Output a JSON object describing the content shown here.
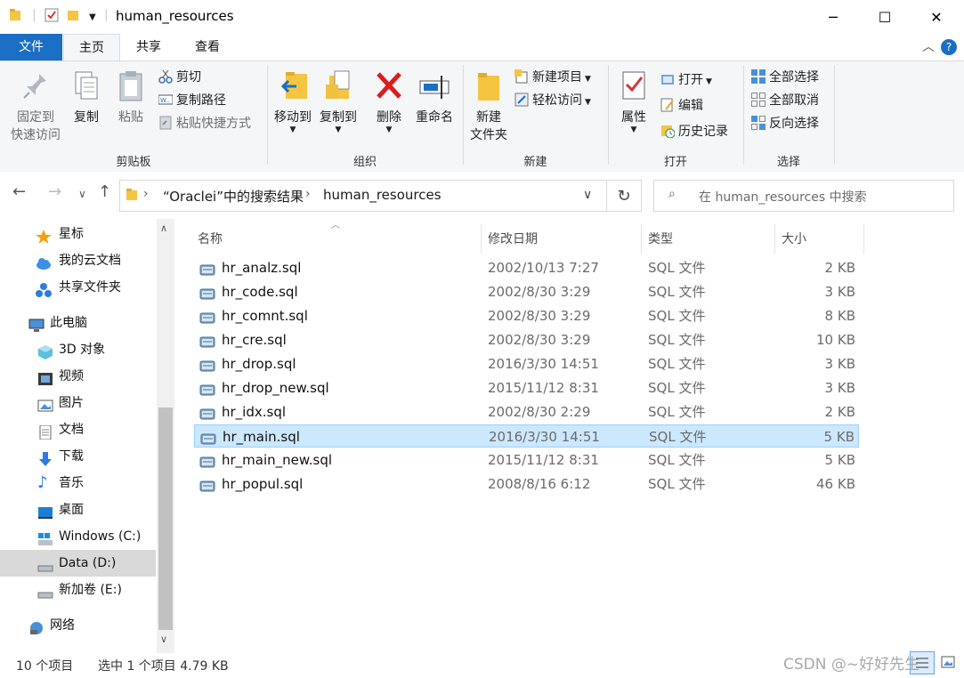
{
  "window": {
    "title": "human_resources",
    "minimize_icon": "minimize-icon",
    "maximize_icon": "maximize-icon",
    "close_icon": "close-icon"
  },
  "tabs": [
    {
      "label": "文件"
    },
    {
      "label": "主页"
    },
    {
      "label": "共享"
    },
    {
      "label": "查看"
    }
  ],
  "ribbon": {
    "clipboard": {
      "pin_label_1": "固定到",
      "pin_label_2": "快速访问",
      "copy": "复制",
      "paste": "粘贴",
      "cut": "剪切",
      "copy_path": "复制路径",
      "paste_shortcut": "粘贴快捷方式",
      "group": "剪贴板"
    },
    "organize": {
      "move_to": "移动到",
      "copy_to": "复制到",
      "delete": "删除",
      "rename": "重命名",
      "group": "组织"
    },
    "new": {
      "new_folder_1": "新建",
      "new_folder_2": "文件夹",
      "new_item": "新建项目",
      "easy_access": "轻松访问",
      "group": "新建"
    },
    "open": {
      "properties": "属性",
      "open": "打开",
      "edit": "编辑",
      "history": "历史记录",
      "group": "打开"
    },
    "select": {
      "select_all": "全部选择",
      "select_none": "全部取消",
      "invert": "反向选择",
      "group": "选择"
    }
  },
  "address": {
    "crumb_1": "“Oraclei”中的搜索结果",
    "crumb_2": "human_resources",
    "search_placeholder": "在 human_resources 中搜索"
  },
  "sidebar": {
    "items": [
      {
        "label": "星标",
        "icon": "star-icon"
      },
      {
        "label": "我的云文档",
        "icon": "cloud-icon"
      },
      {
        "label": "共享文件夹",
        "icon": "share-icon"
      },
      {
        "label": "此电脑",
        "icon": "computer-icon"
      },
      {
        "label": "3D 对象",
        "icon": "3d-objects-icon"
      },
      {
        "label": "视频",
        "icon": "video-icon"
      },
      {
        "label": "图片",
        "icon": "pictures-icon"
      },
      {
        "label": "文档",
        "icon": "documents-icon"
      },
      {
        "label": "下载",
        "icon": "download-icon"
      },
      {
        "label": "音乐",
        "icon": "music-icon"
      },
      {
        "label": "桌面",
        "icon": "desktop-icon"
      },
      {
        "label": "Windows (C:)",
        "icon": "drive-icon"
      },
      {
        "label": "Data (D:)",
        "icon": "drive-icon"
      },
      {
        "label": "新加卷 (E:)",
        "icon": "drive-icon"
      },
      {
        "label": "网络",
        "icon": "network-icon"
      }
    ]
  },
  "columns": {
    "name": "名称",
    "date": "修改日期",
    "type": "类型",
    "size": "大小"
  },
  "files": [
    {
      "name": "hr_analz.sql",
      "date": "2002/10/13 7:27",
      "type": "SQL 文件",
      "size": "2 KB"
    },
    {
      "name": "hr_code.sql",
      "date": "2002/8/30 3:29",
      "type": "SQL 文件",
      "size": "3 KB"
    },
    {
      "name": "hr_comnt.sql",
      "date": "2002/8/30 3:29",
      "type": "SQL 文件",
      "size": "8 KB"
    },
    {
      "name": "hr_cre.sql",
      "date": "2002/8/30 3:29",
      "type": "SQL 文件",
      "size": "10 KB"
    },
    {
      "name": "hr_drop.sql",
      "date": "2016/3/30 14:51",
      "type": "SQL 文件",
      "size": "3 KB"
    },
    {
      "name": "hr_drop_new.sql",
      "date": "2015/11/12 8:31",
      "type": "SQL 文件",
      "size": "3 KB"
    },
    {
      "name": "hr_idx.sql",
      "date": "2002/8/30 2:29",
      "type": "SQL 文件",
      "size": "2 KB"
    },
    {
      "name": "hr_main.sql",
      "date": "2016/3/30 14:51",
      "type": "SQL 文件",
      "size": "5 KB",
      "selected": true
    },
    {
      "name": "hr_main_new.sql",
      "date": "2015/11/12 8:31",
      "type": "SQL 文件",
      "size": "5 KB"
    },
    {
      "name": "hr_popul.sql",
      "date": "2008/8/16 6:12",
      "type": "SQL 文件",
      "size": "46 KB"
    }
  ],
  "status": {
    "count": "10 个项目",
    "selection": "选中 1 个项目  4.79 KB"
  },
  "watermark": "CSDN @~好好先生",
  "colors": {
    "accent": "#1a6ec4",
    "selection": "#cce8ff"
  }
}
